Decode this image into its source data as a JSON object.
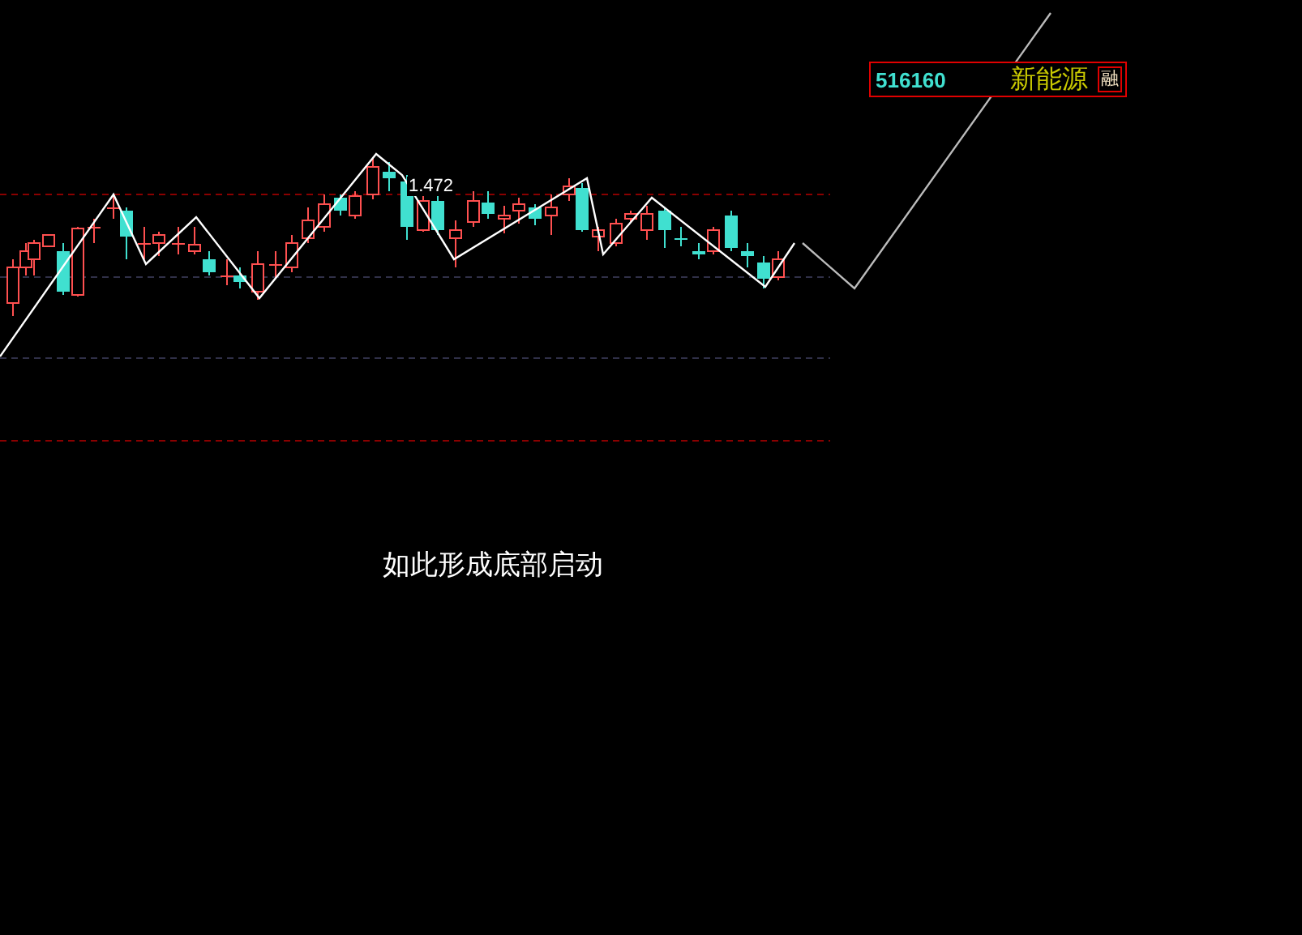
{
  "ticker": {
    "code": "516160",
    "name": "新能源",
    "badge": "融"
  },
  "chart": {
    "price_label": "1.472"
  },
  "caption": "如此形成底部启动"
}
